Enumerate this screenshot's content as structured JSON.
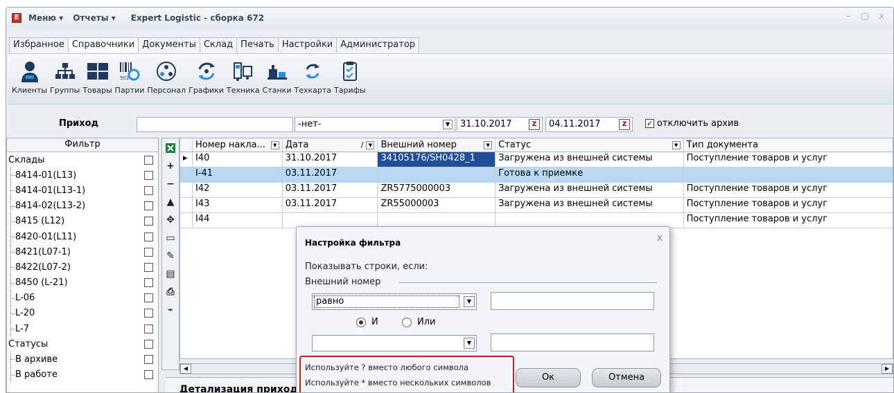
{
  "app": {
    "menu_label": "Меню ▾",
    "reports_label": "Отчеты ▾",
    "title": "Expert Logistic - сборка 672",
    "logo_letter": "E"
  },
  "window_controls": {
    "minimize": "–",
    "maximize": "□",
    "close": "x"
  },
  "tabs": [
    {
      "label": "Избранное"
    },
    {
      "label": "Справочники",
      "active": true
    },
    {
      "label": "Документы"
    },
    {
      "label": "Склад"
    },
    {
      "label": "Печать"
    },
    {
      "label": "Настройки"
    },
    {
      "label": "Администратор"
    }
  ],
  "toolbar": [
    {
      "label": "Клиенты",
      "icon": "clients-icon"
    },
    {
      "label": "Группы",
      "icon": "groups-icon"
    },
    {
      "label": "Товары",
      "icon": "goods-icon"
    },
    {
      "label": "Партии",
      "icon": "batches-icon"
    },
    {
      "label": "Персонал",
      "icon": "personnel-icon"
    },
    {
      "label": "Графики",
      "icon": "schedules-icon"
    },
    {
      "label": "Техника",
      "icon": "machinery-icon"
    },
    {
      "label": "Станки",
      "icon": "machines-icon"
    },
    {
      "label": "Техкарта",
      "icon": "techcard-icon"
    },
    {
      "label": "Тарифы",
      "icon": "tariffs-icon"
    }
  ],
  "filterbar": {
    "section_title": "Приход",
    "search_value": "",
    "status_select": "-нет-",
    "date_from": "31.10.2017",
    "date_to": "04.11.2017",
    "archive_label": "отключить архив",
    "archive_checked": true
  },
  "left_panel": {
    "header": "Фильтр",
    "rows": [
      {
        "label": "Склады",
        "child": false
      },
      {
        "label": "8414-01(L13)",
        "child": true
      },
      {
        "label": "8414-01(L13-1)",
        "child": true
      },
      {
        "label": "8414-02(L13-2)",
        "child": true
      },
      {
        "label": "8415 (L12)",
        "child": true
      },
      {
        "label": "8420-01(L11)",
        "child": true
      },
      {
        "label": "8421(L07-1)",
        "child": true
      },
      {
        "label": "8422(L07-2)",
        "child": true
      },
      {
        "label": "8450 (L-21)",
        "child": true
      },
      {
        "label": "L-06",
        "child": true
      },
      {
        "label": "L-20",
        "child": true
      },
      {
        "label": "L-7",
        "child": true
      },
      {
        "label": "Статусы",
        "child": false
      },
      {
        "label": "В архиве",
        "child": true
      },
      {
        "label": "В работе",
        "child": true
      }
    ]
  },
  "grid": {
    "columns": [
      "Номер накла...",
      "Дата",
      "Внешний номер",
      "Статус",
      "Тип документа"
    ],
    "rows": [
      [
        "I40",
        "31.10.2017",
        "34105176/SH0428_1",
        "Загружена из внешней системы",
        "Поступление товаров и услуг"
      ],
      [
        "I-41",
        "03.11.2017",
        "",
        "Готова к приемке",
        ""
      ],
      [
        "I42",
        "03.11.2017",
        "ZR5775000003",
        "Загружена из внешней системы",
        "Поступление товаров и услуг"
      ],
      [
        "I43",
        "03.11.2017",
        "ZR55000003",
        "Загружена из внешней системы",
        "Поступление товаров и услуг"
      ],
      [
        "I44",
        "",
        "",
        "",
        "Поступление товаров и услуг"
      ]
    ],
    "sort_indicator": "/"
  },
  "detail": {
    "title": "Детализация приходной накладной"
  },
  "dialog": {
    "title": "Настройка фильтра",
    "close": "x",
    "subtitle": "Показывать строки, если:",
    "field_label": "Внешний номер",
    "condition1": "равно",
    "value1": "",
    "and_label": "И",
    "or_label": "Или",
    "condition2": "",
    "value2": "",
    "hint1": "Используйте ? вместо любого символа",
    "hint2": "Используйте * вместо нескольких символов",
    "ok_label": "Ок",
    "cancel_label": "Отмена"
  }
}
